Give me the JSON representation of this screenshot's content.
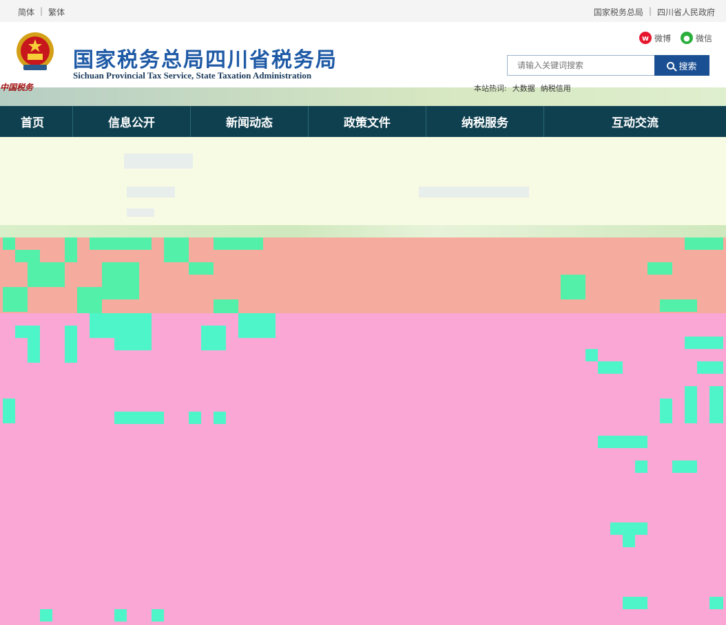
{
  "topbar": {
    "simplified": "简体",
    "traditional": "繁体",
    "sep": "|",
    "sat_link": "国家税务总局",
    "gov_link": "四川省人民政府"
  },
  "header": {
    "title": "国家税务总局四川省税务局",
    "subtitle": "Sichuan Provincial Tax Service, State Taxation Administration",
    "motto": "中国税务"
  },
  "social": {
    "weibo": "微博",
    "wechat": "微信"
  },
  "search": {
    "placeholder": "请输入关键词搜索",
    "button": "搜索"
  },
  "hotwords": {
    "label": "本站热词:",
    "items": [
      "大数据",
      "纳税信用"
    ]
  },
  "nav": {
    "items": [
      "首页",
      "信息公开",
      "新闻动态",
      "政策文件",
      "纳税服务",
      "互动交流"
    ]
  },
  "colors": {
    "nav_bg": "#0f4050",
    "title_blue": "#1f5aa6",
    "search_button": "#1a4f93",
    "panel_bg": "#f8fbe3"
  }
}
